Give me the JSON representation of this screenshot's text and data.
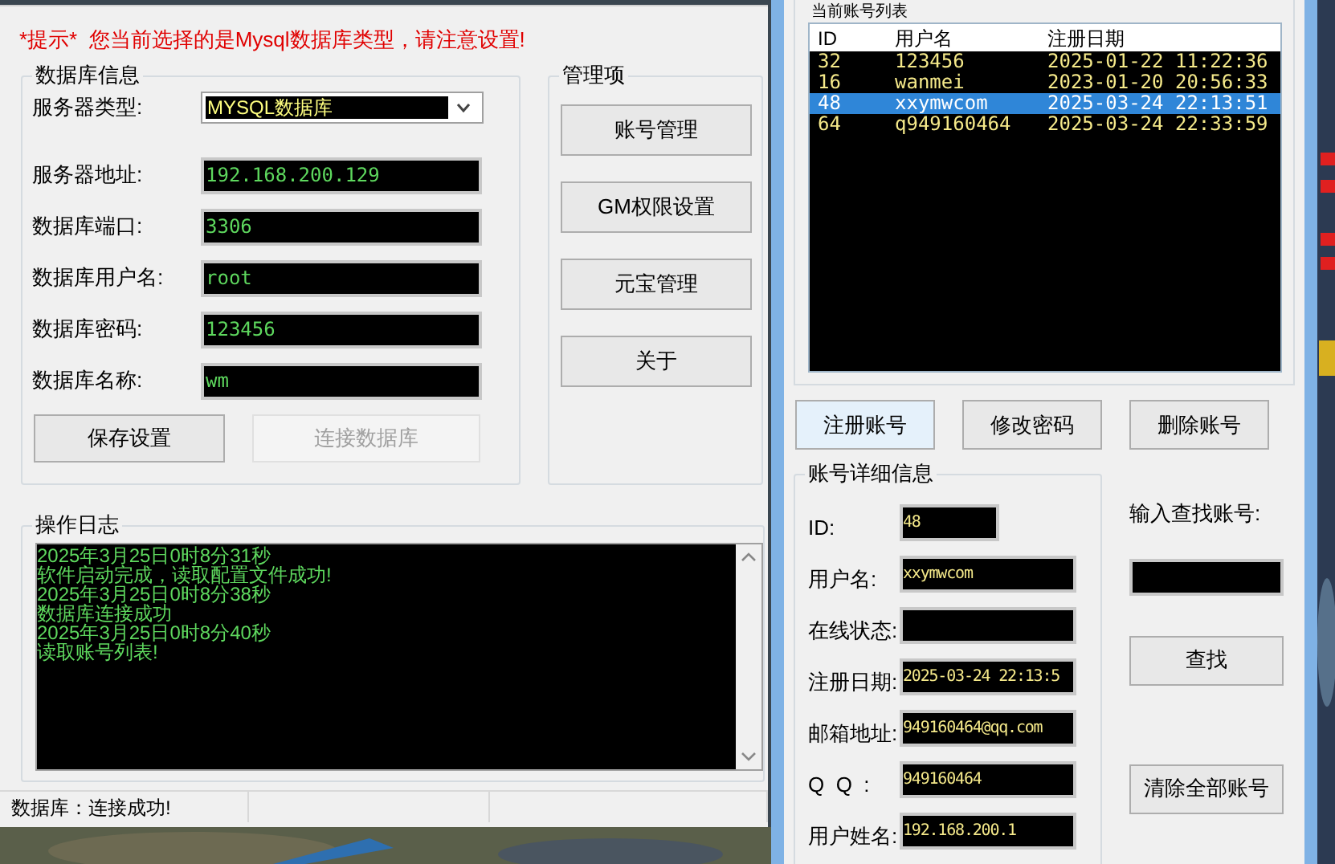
{
  "left_window": {
    "notice": "*提示*  您当前选择的是Mysql数据库类型，请注意设置!",
    "database_group": {
      "title": "数据库信息",
      "fields": [
        {
          "label": "服务器类型:",
          "value": "MYSQL数据库",
          "kind": "combo"
        },
        {
          "label": "服务器地址:",
          "value": "192.168.200.129",
          "kind": "text"
        },
        {
          "label": "数据库端口:",
          "value": "3306",
          "kind": "text"
        },
        {
          "label": "数据库用户名:",
          "value": "root",
          "kind": "text"
        },
        {
          "label": "数据库密码:",
          "value": "123456",
          "kind": "text"
        },
        {
          "label": "数据库名称:",
          "value": "wm",
          "kind": "text"
        }
      ],
      "buttons": [
        {
          "label": "保存设置",
          "disabled": false
        },
        {
          "label": "连接数据库",
          "disabled": true
        }
      ]
    },
    "management": {
      "title": "管理项",
      "buttons": [
        "账号管理",
        "GM权限设置",
        "元宝管理",
        "关于"
      ]
    },
    "log": {
      "title": "操作日志",
      "lines": [
        "2025年3月25日0时8分31秒",
        "软件启动完成，读取配置文件成功!",
        "2025年3月25日0时8分38秒",
        "数据库连接成功",
        "2025年3月25日0时8分40秒",
        "读取账号列表!"
      ]
    },
    "status_bar": [
      "数据库：连接成功!"
    ]
  },
  "right_window": {
    "account_list": {
      "title": "当前账号列表",
      "columns": [
        "ID",
        "用户名",
        "注册日期"
      ],
      "rows": [
        {
          "cells": [
            "32",
            "123456",
            "2025-01-22 11:22:36"
          ],
          "selected": false
        },
        {
          "cells": [
            "16",
            "wanmei",
            "2023-01-20 20:56:33"
          ],
          "selected": false
        },
        {
          "cells": [
            "48",
            "xxymwcom",
            "2025-03-24 22:13:51"
          ],
          "selected": true
        },
        {
          "cells": [
            "64",
            "q949160464",
            "2025-03-24 22:33:59"
          ],
          "selected": false
        }
      ]
    },
    "action_buttons": [
      {
        "label": "注册账号",
        "focused": true
      },
      {
        "label": "修改密码",
        "focused": false
      },
      {
        "label": "删除账号",
        "focused": false
      }
    ],
    "detail": {
      "title": "账号详细信息",
      "fields": [
        {
          "label": "ID:",
          "value": "48",
          "kind": "short"
        },
        {
          "label": "用户名:",
          "value": "xxymwcom",
          "kind": "text"
        },
        {
          "label": "在线状态:",
          "kind": "text"
        },
        {
          "label": "注册日期:",
          "value": "2025-03-24 22:13:5",
          "kind": "text"
        },
        {
          "label": "邮箱地址:",
          "value": "949160464@qq.com",
          "kind": "text"
        },
        {
          "label": "Q  Q  :",
          "value": "949160464",
          "kind": "text"
        },
        {
          "label": "用户姓名:",
          "value": "192.168.200.1",
          "kind": "text"
        }
      ]
    },
    "search": {
      "label": "输入查找账号:",
      "buttons": [
        "查找",
        "清除全部账号"
      ]
    }
  }
}
